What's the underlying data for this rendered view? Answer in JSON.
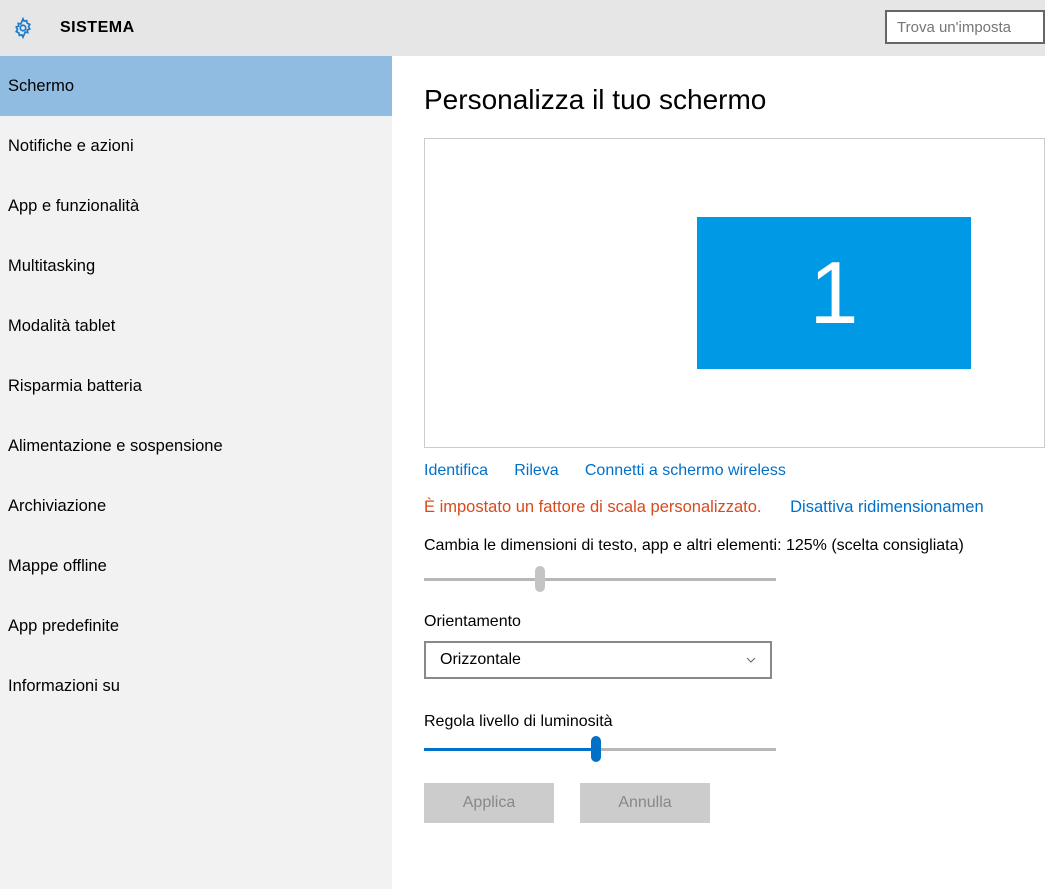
{
  "header": {
    "title": "SISTEMA",
    "search_placeholder": "Trova un'imposta"
  },
  "sidebar": {
    "items": [
      {
        "label": "Schermo",
        "selected": true
      },
      {
        "label": "Notifiche e azioni"
      },
      {
        "label": "App e funzionalità"
      },
      {
        "label": "Multitasking"
      },
      {
        "label": "Modalità tablet"
      },
      {
        "label": "Risparmia batteria"
      },
      {
        "label": "Alimentazione e sospensione"
      },
      {
        "label": "Archiviazione"
      },
      {
        "label": "Mappe offline"
      },
      {
        "label": "App predefinite"
      },
      {
        "label": "Informazioni su"
      }
    ]
  },
  "main": {
    "heading": "Personalizza il tuo schermo",
    "monitor_number": "1",
    "links": {
      "identify": "Identifica",
      "detect": "Rileva",
      "connect_wireless": "Connetti a schermo wireless"
    },
    "scale_warning": "È impostato un fattore di scala personalizzato.",
    "scale_disable_link": "Disattiva ridimensionamen",
    "scale_label": "Cambia le dimensioni di testo, app e altri elementi: 125% (scelta consigliata)",
    "scale_slider_percent": 33,
    "orientation_label": "Orientamento",
    "orientation_value": "Orizzontale",
    "brightness_label": "Regola livello di luminosità",
    "brightness_slider_percent": 49,
    "apply_label": "Applica",
    "cancel_label": "Annulla"
  }
}
